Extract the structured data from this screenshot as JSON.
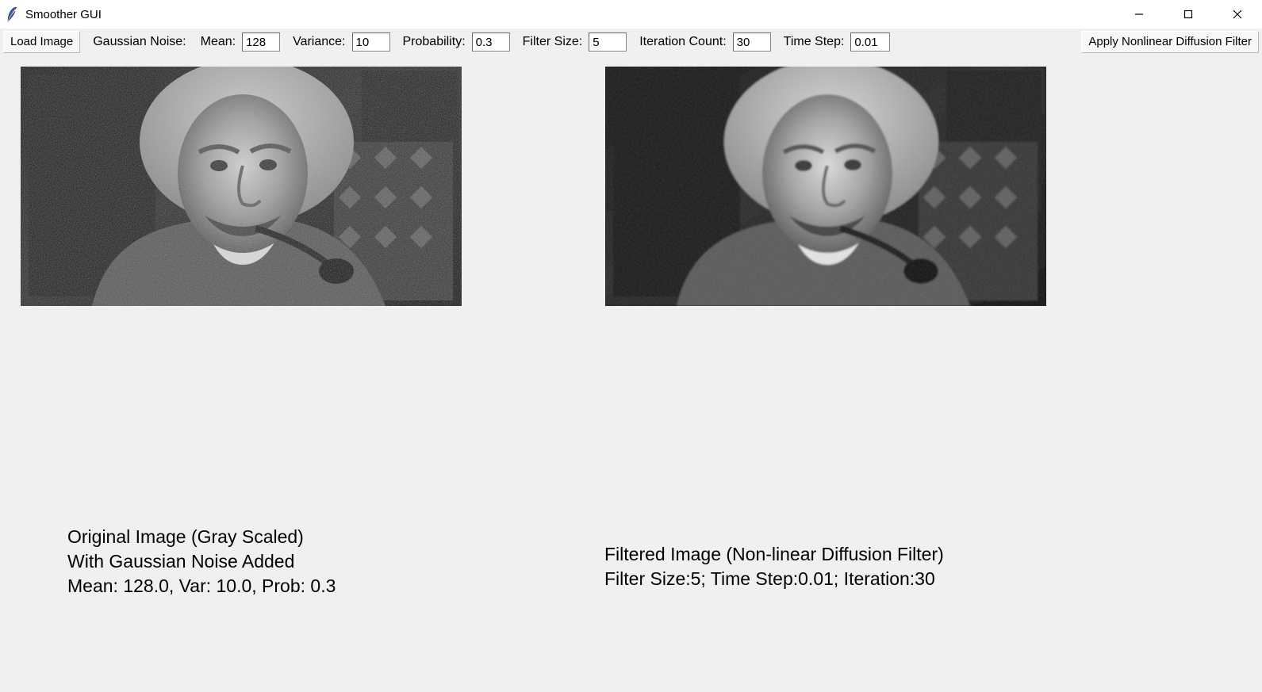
{
  "window": {
    "title": "Smoother GUI"
  },
  "toolbar": {
    "load_button": "Load Image",
    "gaussian_noise_label": "Gaussian Noise:",
    "mean_label": "Mean:",
    "mean_value": "128",
    "variance_label": "Variance:",
    "variance_value": "10",
    "probability_label": "Probability:",
    "probability_value": "0.3",
    "filter_size_label": "Filter Size:",
    "filter_size_value": "5",
    "iteration_count_label": "Iteration Count:",
    "iteration_count_value": "30",
    "time_step_label": "Time Step:",
    "time_step_value": "0.01",
    "apply_button": "Apply Nonlinear Diffusion Filter"
  },
  "captions": {
    "left": "Original Image (Gray Scaled)\nWith Gaussian Noise Added\nMean: 128.0, Var: 10.0, Prob: 0.3",
    "right": "Filtered Image (Non-linear Diffusion Filter)\nFilter Size:5; Time Step:0.01; Iteration:30"
  },
  "images": {
    "left_alt": "noisy-grayscale-photo",
    "right_alt": "filtered-grayscale-photo"
  }
}
